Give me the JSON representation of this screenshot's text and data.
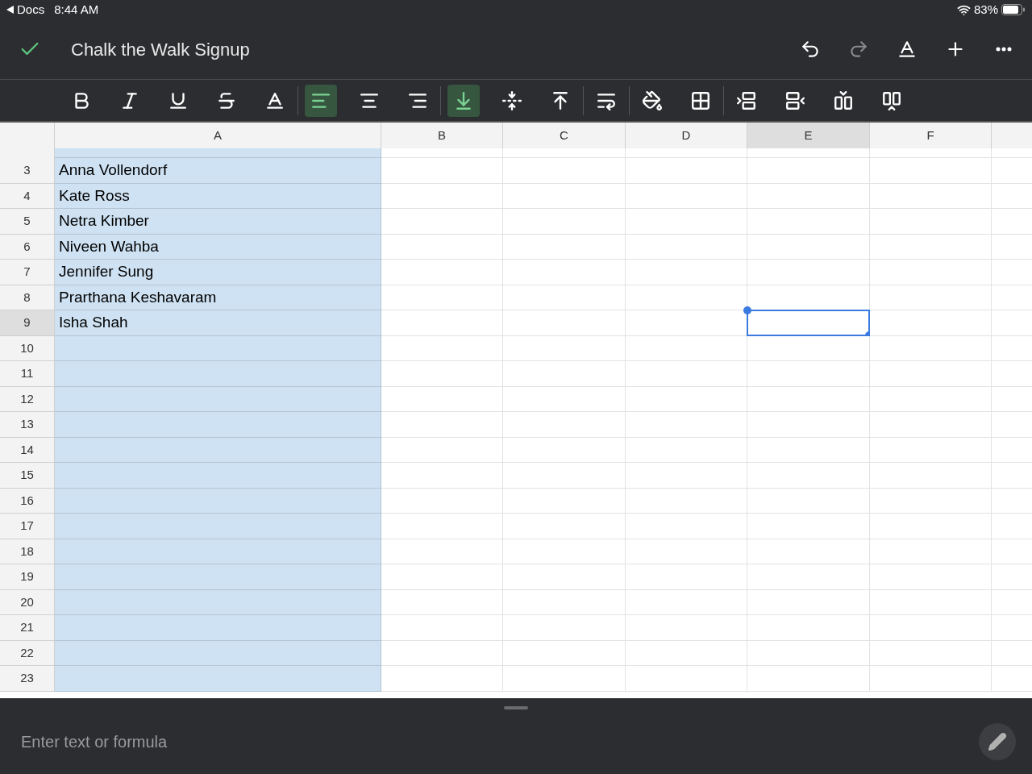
{
  "status_bar": {
    "back_label": "Docs",
    "time": "8:44 AM",
    "battery": "83%"
  },
  "title_bar": {
    "title": "Chalk the Walk Signup",
    "actions": [
      {
        "kind": "undo",
        "disabled": false
      },
      {
        "kind": "redo",
        "disabled": true
      },
      {
        "kind": "text-format",
        "disabled": false
      },
      {
        "kind": "insert",
        "disabled": false
      },
      {
        "kind": "more",
        "disabled": false
      }
    ]
  },
  "toolbar": [
    [
      {
        "kind": "bold",
        "selected": false
      },
      {
        "kind": "italic",
        "selected": false
      },
      {
        "kind": "underline",
        "selected": false
      },
      {
        "kind": "strikethrough",
        "selected": false
      },
      {
        "kind": "text-color",
        "selected": false
      }
    ],
    [
      {
        "kind": "align-left",
        "selected": true
      },
      {
        "kind": "align-center",
        "selected": false
      },
      {
        "kind": "align-right",
        "selected": false
      }
    ],
    [
      {
        "kind": "valign-bottom",
        "selected": true
      },
      {
        "kind": "valign-middle",
        "selected": false
      },
      {
        "kind": "valign-top",
        "selected": false
      }
    ],
    [
      {
        "kind": "wrap",
        "selected": false
      }
    ],
    [
      {
        "kind": "fill-color",
        "selected": false
      },
      {
        "kind": "borders",
        "selected": false
      }
    ],
    [
      {
        "kind": "insert-row-above",
        "selected": false
      },
      {
        "kind": "insert-row-below",
        "selected": false
      },
      {
        "kind": "insert-column-left",
        "selected": false
      },
      {
        "kind": "insert-column-right",
        "selected": false
      }
    ]
  ],
  "sheet": {
    "columns": [
      {
        "label": "A",
        "selected": false,
        "filled": true
      },
      {
        "label": "B",
        "selected": false,
        "filled": false
      },
      {
        "label": "C",
        "selected": false,
        "filled": false
      },
      {
        "label": "D",
        "selected": false,
        "filled": false
      },
      {
        "label": "E",
        "selected": true,
        "filled": false
      },
      {
        "label": "F",
        "selected": false,
        "filled": false
      }
    ],
    "rows": [
      {
        "number": "3",
        "selected": false,
        "cells": [
          "Anna Vollendorf"
        ]
      },
      {
        "number": "4",
        "selected": false,
        "cells": [
          "Kate Ross"
        ]
      },
      {
        "number": "5",
        "selected": false,
        "cells": [
          "Netra Kimber"
        ]
      },
      {
        "number": "6",
        "selected": false,
        "cells": [
          "Niveen Wahba"
        ]
      },
      {
        "number": "7",
        "selected": false,
        "cells": [
          "Jennifer Sung"
        ]
      },
      {
        "number": "8",
        "selected": false,
        "cells": [
          "Prarthana Keshavaram"
        ]
      },
      {
        "number": "9",
        "selected": true,
        "cells": [
          "Isha Shah"
        ]
      },
      {
        "number": "10",
        "selected": false,
        "cells": []
      },
      {
        "number": "11",
        "selected": false,
        "cells": []
      },
      {
        "number": "12",
        "selected": false,
        "cells": []
      },
      {
        "number": "13",
        "selected": false,
        "cells": []
      },
      {
        "number": "14",
        "selected": false,
        "cells": []
      },
      {
        "number": "15",
        "selected": false,
        "cells": []
      },
      {
        "number": "16",
        "selected": false,
        "cells": []
      },
      {
        "number": "17",
        "selected": false,
        "cells": []
      },
      {
        "number": "18",
        "selected": false,
        "cells": []
      },
      {
        "number": "19",
        "selected": false,
        "cells": []
      },
      {
        "number": "20",
        "selected": false,
        "cells": []
      },
      {
        "number": "21",
        "selected": false,
        "cells": []
      },
      {
        "number": "22",
        "selected": false,
        "cells": []
      },
      {
        "number": "23",
        "selected": false,
        "cells": []
      }
    ]
  },
  "formula_bar": {
    "placeholder": "Enter text or formula"
  }
}
